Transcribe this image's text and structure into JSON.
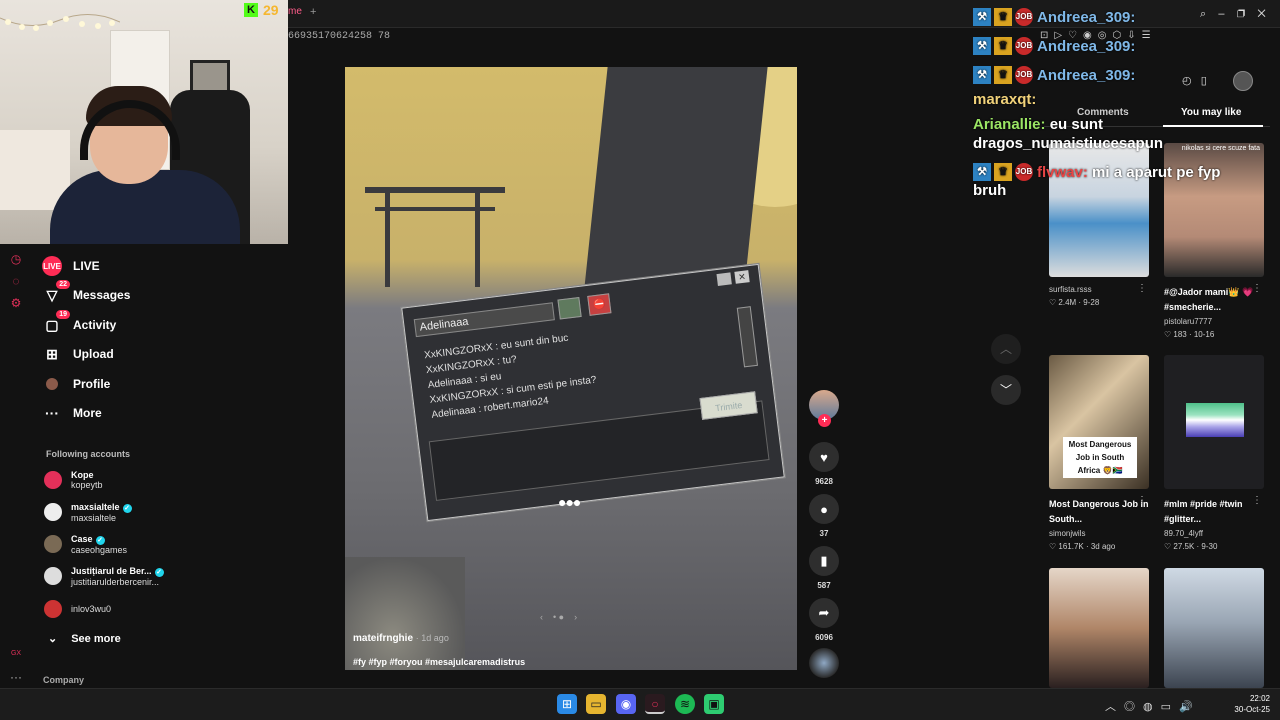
{
  "kick": {
    "count": "29"
  },
  "browser": {
    "tab_stub": "me",
    "url_fragment": "66935170624258 78"
  },
  "sidebar": {
    "nav": [
      {
        "label": "LIVE"
      },
      {
        "label": "Messages",
        "badge": "22"
      },
      {
        "label": "Activity",
        "badge": "19"
      },
      {
        "label": "Upload"
      },
      {
        "label": "Profile"
      },
      {
        "label": "More"
      }
    ],
    "following_title": "Following accounts",
    "accounts": [
      {
        "name": "Kope",
        "handle": "kopeytb"
      },
      {
        "name": "maxsialtele",
        "handle": "maxsialtele"
      },
      {
        "name": "Case",
        "handle": "caseohgames"
      },
      {
        "name": "Justițiarul de Ber...",
        "handle": "justitiarulderbercenir..."
      },
      {
        "name": "",
        "handle": "inlov3wu0"
      }
    ],
    "see_more": "See more",
    "company": "Company"
  },
  "video": {
    "chat_title": "Adelinaaa",
    "chat_lines": [
      "XxKINGZORxX : eu sunt din buc",
      "XxKINGZORxX : tu?",
      "Adelinaaa : si eu",
      "XxKINGZORxX : si cum esti pe insta?",
      "Adelinaaa : robert.mario24"
    ],
    "send_label": "Trimite",
    "author": "mateifrnghie",
    "date": "· 1d ago",
    "hashtags": "#fy #fyp #foryou #mesajulcaremadistrus"
  },
  "actions": {
    "likes": "9628",
    "comments": "37",
    "saves": "587",
    "shares": "6096"
  },
  "stream_chat": [
    {
      "nick": "Andreea_309:",
      "msg": "",
      "badges": true,
      "color": "blue"
    },
    {
      "nick": "Andreea_309:",
      "msg": "",
      "badges": true,
      "color": "blue"
    },
    {
      "nick": "Andreea_309:",
      "msg": "",
      "badges": true,
      "color": "blue"
    },
    {
      "nick": "maraxqt:",
      "msg": "",
      "badges": false,
      "color": "yellow"
    },
    {
      "nick": "Arianallie:",
      "msg": "eu sunt",
      "badges": false,
      "color": "green"
    },
    {
      "nick": "",
      "msg": "dragos_numaistiucesapun",
      "badges": false,
      "color": "white"
    },
    {
      "nick": "flvwav:",
      "msg": "mi a aparut pe fyp",
      "badges": true,
      "color": "red"
    },
    {
      "nick": "",
      "msg": "bruh",
      "badges": false,
      "color": "white"
    }
  ],
  "right_panel": {
    "tab_comments": "Comments",
    "tab_you_may_like": "You may like",
    "cards": [
      {
        "caption": "",
        "user": "surfista.rsss",
        "stats": "♡ 2.4M · 9-28",
        "top": ""
      },
      {
        "caption": "#@Jador mami👑 💗 #smecherie...",
        "user": "pistolaru7777",
        "stats": "♡ 183 · 10-16",
        "top": "nikolas si cere scuze fata"
      },
      {
        "caption": "Most Dangerous Job in South...",
        "user": "simonjwils",
        "stats": "♡ 161.7K · 3d ago",
        "label": "Most Dangerous Job in South Africa 🦁🇿🇦"
      },
      {
        "caption": "#mlm #pride #twin #glitter...",
        "user": "89.70_4lyff",
        "stats": "♡ 27.5K · 9-30",
        "top": ""
      },
      {
        "caption": "",
        "user": "",
        "stats": "",
        "top": ""
      },
      {
        "caption": "",
        "user": "",
        "stats": "",
        "top": ""
      }
    ]
  },
  "taskbar": {
    "time": "22:02",
    "date": "30-Oct-25"
  },
  "colors": {
    "accent": "#fe2c55",
    "verified": "#20d5ec",
    "kick": "#53fc18"
  }
}
